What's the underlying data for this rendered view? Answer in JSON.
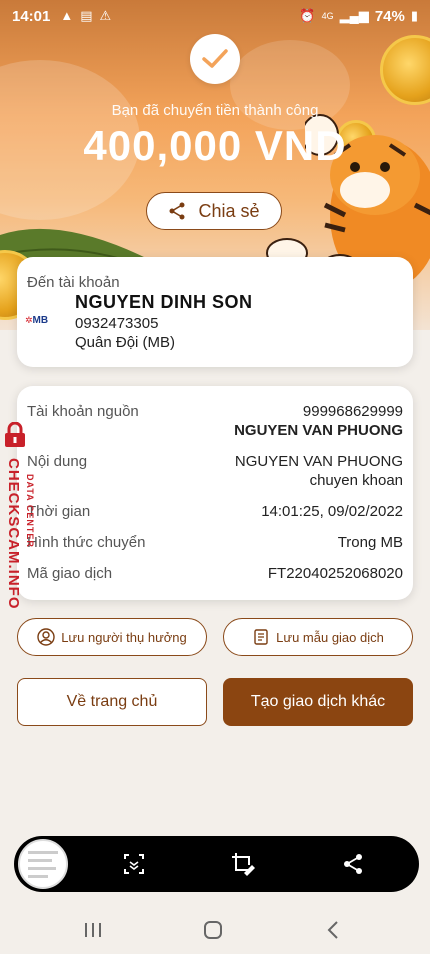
{
  "status_bar": {
    "time": "14:01",
    "network": "4G",
    "battery": "74%"
  },
  "header": {
    "success_message": "Bạn đã chuyển tiền thành công",
    "amount": "400,000 VND",
    "share_label": "Chia sẻ"
  },
  "recipient": {
    "label": "Đến tài khoản",
    "bank_logo": "MB",
    "name": "NGUYEN DINH SON",
    "account_number": "0932473305",
    "bank_name": "Quân Đội (MB)"
  },
  "details": {
    "source_label": "Tài khoản nguồn",
    "source_account": "999968629999",
    "source_name": "NGUYEN VAN PHUONG",
    "content_label": "Nội dung",
    "content_line1": "NGUYEN VAN PHUONG",
    "content_line2": "chuyen khoan",
    "time_label": "Thời gian",
    "time_value": "14:01:25, 09/02/2022",
    "method_label": "Hình thức chuyển",
    "method_value": "Trong MB",
    "transaction_label": "Mã giao dịch",
    "transaction_id": "FT22040252068020"
  },
  "watermark": {
    "main": "CHECKSCAM.INFO",
    "sub": "DATA CENTER"
  },
  "actions": {
    "save_beneficiary": "Lưu người thụ hưởng",
    "save_template": "Lưu mẫu giao dịch",
    "home": "Về trang chủ",
    "new_transaction": "Tạo giao dịch khác"
  },
  "colors": {
    "brand": "#8b4511",
    "watermark": "#c8212a"
  }
}
